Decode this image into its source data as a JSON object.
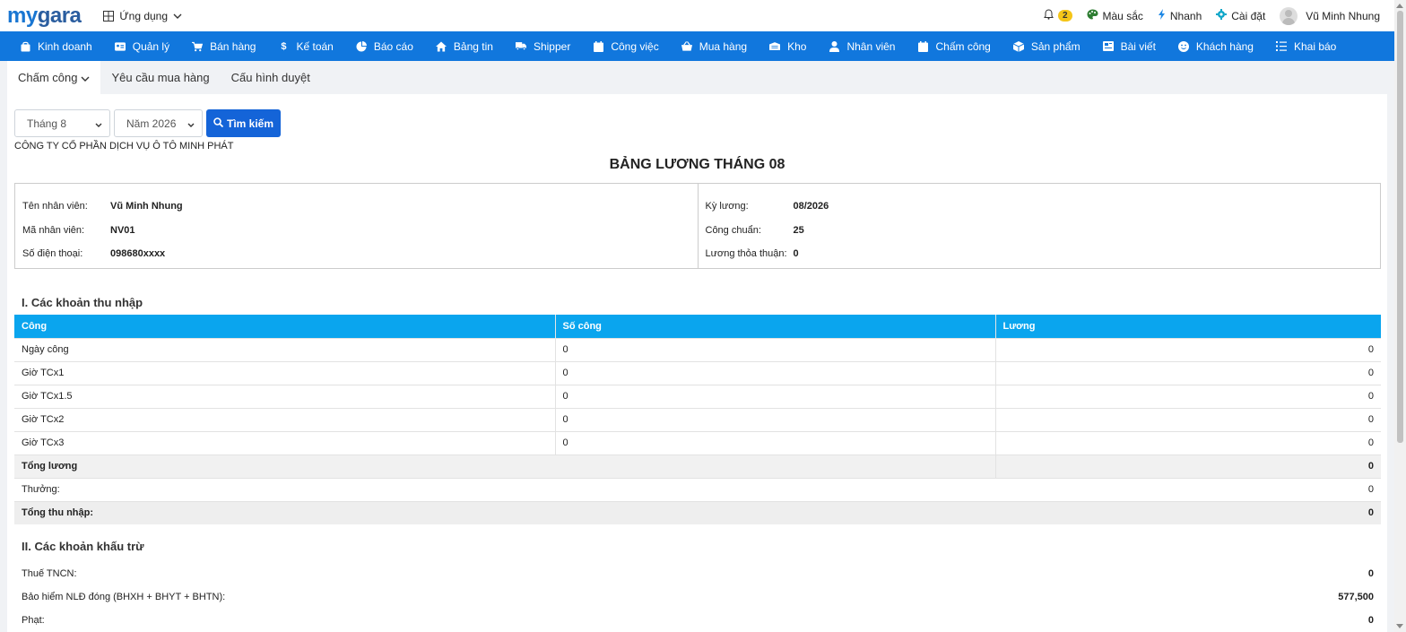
{
  "header": {
    "logo_my": "my",
    "logo_gara": "gara",
    "apps_label": "Ứng dụng",
    "notification_count": "2",
    "color_label": "Màu sắc",
    "quick_label": "Nhanh",
    "settings_label": "Cài đặt",
    "user_name": "Vũ Minh Nhung"
  },
  "nav": {
    "items": [
      {
        "label": "Kinh doanh",
        "icon": "bag-icon"
      },
      {
        "label": "Quản lý",
        "icon": "id-card-icon"
      },
      {
        "label": "Bán hàng",
        "icon": "cart-icon"
      },
      {
        "label": "Kế toán",
        "icon": "dollar-icon"
      },
      {
        "label": "Báo cáo",
        "icon": "pie-chart-icon"
      },
      {
        "label": "Bảng tin",
        "icon": "home-icon"
      },
      {
        "label": "Shipper",
        "icon": "truck-icon"
      },
      {
        "label": "Công việc",
        "icon": "calendar-icon"
      },
      {
        "label": "Mua hàng",
        "icon": "basket-icon"
      },
      {
        "label": "Kho",
        "icon": "warehouse-icon"
      },
      {
        "label": "Nhân viên",
        "icon": "user-icon"
      },
      {
        "label": "Chấm công",
        "icon": "calendar-check-icon"
      },
      {
        "label": "Sản phẩm",
        "icon": "box-icon"
      },
      {
        "label": "Bài viết",
        "icon": "article-icon"
      },
      {
        "label": "Khách hàng",
        "icon": "smile-icon"
      },
      {
        "label": "Khai báo",
        "icon": "list-icon"
      }
    ]
  },
  "subtabs": {
    "items": [
      {
        "label": "Chấm công"
      },
      {
        "label": "Yêu cầu mua hàng"
      },
      {
        "label": "Cấu hình duyệt"
      }
    ]
  },
  "filters": {
    "month": "Tháng 8",
    "year": "Năm 2026",
    "search_label": "Tìm kiếm"
  },
  "company": "CÔNG TY CỔ PHẦN DỊCH VỤ Ô TÔ MINH PHÁT",
  "title": "BẢNG LƯƠNG THÁNG 08",
  "employee": {
    "name_label": "Tên nhân viên:",
    "name": "Vũ Minh Nhung",
    "code_label": "Mã nhân viên:",
    "code": "NV01",
    "phone_label": "Số điện thoại:",
    "phone": "098680xxxx",
    "period_label": "Kỳ lương:",
    "period": "08/2026",
    "standard_label": "Công chuẩn:",
    "standard": "25",
    "agreed_label": "Lương thỏa thuận:",
    "agreed": "0"
  },
  "income": {
    "section_title": "I. Các khoản thu nhập",
    "headers": [
      "Công",
      "Số công",
      "Lương"
    ],
    "rows": [
      {
        "name": "Ngày công",
        "count": "0",
        "salary": "0"
      },
      {
        "name": "Giờ TCx1",
        "count": "0",
        "salary": "0"
      },
      {
        "name": "Giờ TCx1.5",
        "count": "0",
        "salary": "0"
      },
      {
        "name": "Giờ TCx2",
        "count": "0",
        "salary": "0"
      },
      {
        "name": "Giờ TCx3",
        "count": "0",
        "salary": "0"
      }
    ],
    "total_label": "Tổng lương",
    "total_value": "0",
    "bonus_label": "Thưởng:",
    "bonus_value": "0",
    "sum_label": "Tổng thu nhập:",
    "sum_value": "0"
  },
  "deductions": {
    "section_title": "II. Các khoản khấu trừ",
    "rows": [
      {
        "label": "Thuế TNCN:",
        "value": "0"
      },
      {
        "label": "Bảo hiểm NLĐ đóng (BHXH + BHYT + BHTN):",
        "value": "577,500"
      },
      {
        "label": "Phạt:",
        "value": "0"
      }
    ]
  },
  "colors": {
    "nav_bg": "#1177dd",
    "table_header_bg": "#0aa5ee",
    "search_button_bg": "#1464d8",
    "badge_bg": "#f5c518"
  }
}
